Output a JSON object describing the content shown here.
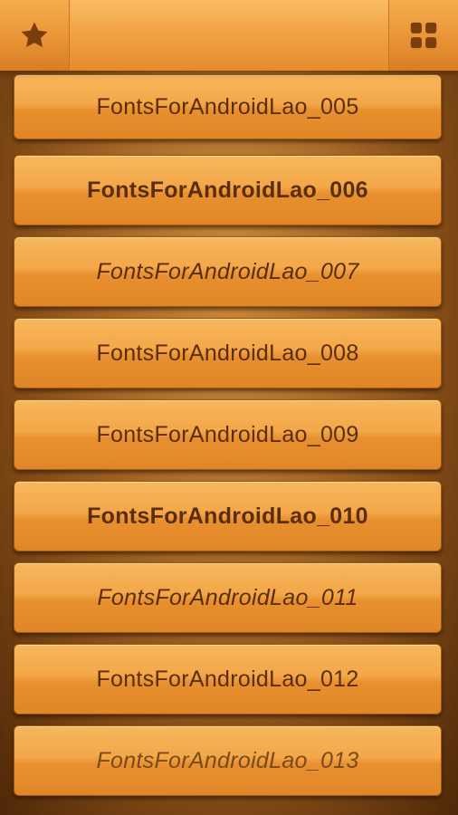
{
  "header": {
    "left_icon": "star-icon",
    "right_icon": "grid-icon",
    "title": ""
  },
  "items": [
    {
      "label": "FontsForAndroidLao_005",
      "style": "normal"
    },
    {
      "label": "FontsForAndroidLao_006",
      "style": "bold"
    },
    {
      "label": "FontsForAndroidLao_007",
      "style": "italic"
    },
    {
      "label": "FontsForAndroidLao_008",
      "style": "normal"
    },
    {
      "label": "FontsForAndroidLao_009",
      "style": "normal"
    },
    {
      "label": "FontsForAndroidLao_010",
      "style": "bold"
    },
    {
      "label": "FontsForAndroidLao_011",
      "style": "italic"
    },
    {
      "label": "FontsForAndroidLao_012",
      "style": "normal"
    },
    {
      "label": "FontsForAndroidLao_013",
      "style": "light"
    }
  ],
  "colors": {
    "accent": "#f0a03c",
    "text": "#5a2e0c"
  }
}
